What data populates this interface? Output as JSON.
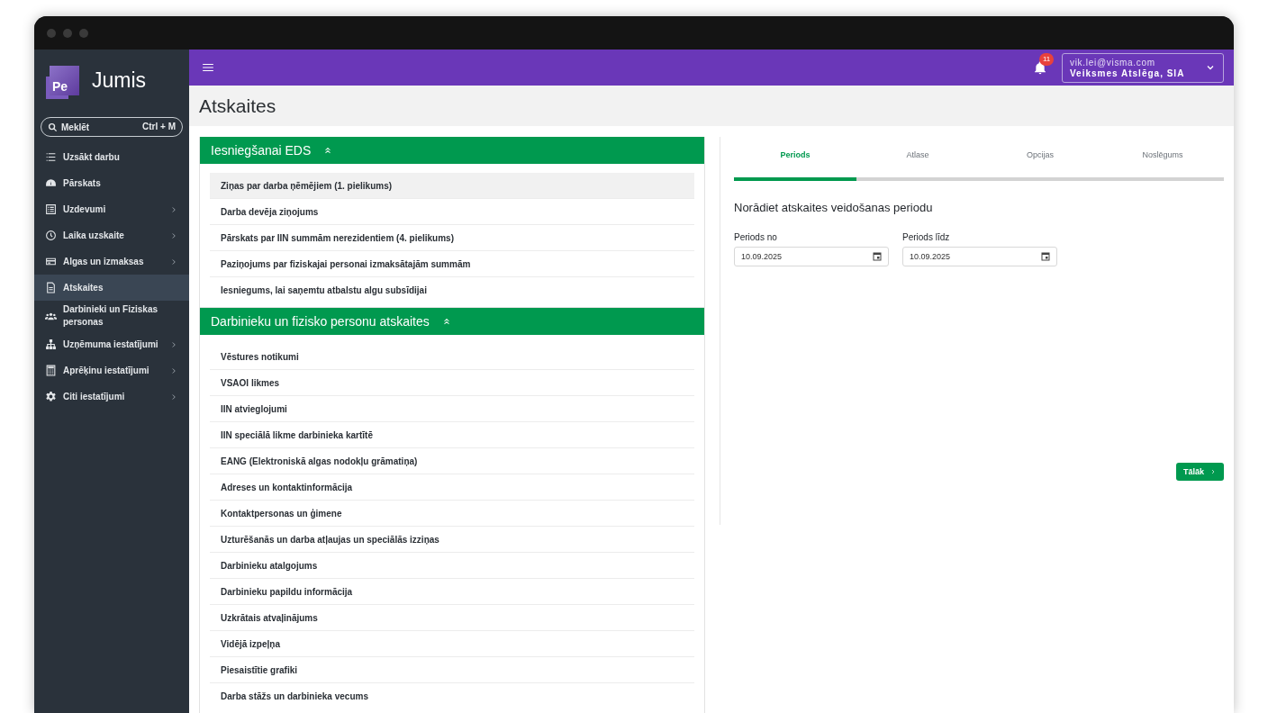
{
  "sidebar": {
    "logo": {
      "mark": "Pe",
      "name": "Jumis"
    },
    "search": {
      "placeholder": "Meklēt",
      "shortcut": "Ctrl + M"
    },
    "items": [
      {
        "label": "Uzsākt darbu",
        "expandable": false,
        "selected": false
      },
      {
        "label": "Pārskats",
        "expandable": false,
        "selected": false
      },
      {
        "label": "Uzdevumi",
        "expandable": true,
        "selected": false
      },
      {
        "label": "Laika uzskaite",
        "expandable": true,
        "selected": false
      },
      {
        "label": "Algas un izmaksas",
        "expandable": true,
        "selected": false
      },
      {
        "label": "Atskaites",
        "expandable": false,
        "selected": true
      },
      {
        "label": "Darbinieki un Fiziskas personas",
        "expandable": false,
        "selected": false
      },
      {
        "label": "Uzņēmuma iestatījumi",
        "expandable": true,
        "selected": false
      },
      {
        "label": "Aprēķinu iestatījumi",
        "expandable": true,
        "selected": false
      },
      {
        "label": "Citi iestatījumi",
        "expandable": true,
        "selected": false
      }
    ]
  },
  "topbar": {
    "notifications": "11",
    "account": {
      "email": "vik.lei@visma.com",
      "company": "Veiksmes Atslēga, SIA"
    }
  },
  "page_title": "Atskaites",
  "sections": [
    {
      "title": "Iesniegšanai EDS",
      "expanded": true,
      "items": [
        {
          "label": "Ziņas par darba ņēmējiem (1. pielikums)",
          "selected": true
        },
        {
          "label": "Darba devēja ziņojums",
          "selected": false
        },
        {
          "label": "Pārskats par IIN summām nerezidentiem (4. pielikums)",
          "selected": false
        },
        {
          "label": "Paziņojums par fiziskajai personai izmaksātajām summām",
          "selected": false
        },
        {
          "label": "Iesniegums, lai saņemtu atbalstu algu subsīdijai",
          "selected": false
        }
      ]
    },
    {
      "title": "Darbinieku un fizisko personu atskaites",
      "expanded": true,
      "items": [
        {
          "label": "Vēstures notikumi",
          "selected": false
        },
        {
          "label": "VSAOI likmes",
          "selected": false
        },
        {
          "label": "IIN atvieglojumi",
          "selected": false
        },
        {
          "label": "IIN speciālā likme darbinieka kartītē",
          "selected": false
        },
        {
          "label": "EANG (Elektroniskā algas nodokļu grāmatiņa)",
          "selected": false
        },
        {
          "label": "Adreses un kontaktinformācija",
          "selected": false
        },
        {
          "label": "Kontaktpersonas un ģimene",
          "selected": false
        },
        {
          "label": "Uzturēšanās un darba atļaujas un speciālās izziņas",
          "selected": false
        },
        {
          "label": "Darbinieku atalgojums",
          "selected": false
        },
        {
          "label": "Darbinieku papildu informācija",
          "selected": false
        },
        {
          "label": "Uzkrātais atvaļinājums",
          "selected": false
        },
        {
          "label": "Vidējā izpeļņa",
          "selected": false
        },
        {
          "label": "Piesaistītie grafiki",
          "selected": false
        },
        {
          "label": "Darba stāžs un darbinieka vecums",
          "selected": false
        }
      ]
    }
  ],
  "wizard": {
    "steps": [
      {
        "label": "Periods",
        "selected": true
      },
      {
        "label": "Atlase",
        "selected": false
      },
      {
        "label": "Opcijas",
        "selected": false
      },
      {
        "label": "Noslēgums",
        "selected": false
      }
    ],
    "heading": "Norādiet atskaites veidošanas periodu",
    "fields": [
      {
        "label": "Periods no",
        "value": "10.09.2025"
      },
      {
        "label": "Periods līdz",
        "value": "10.09.2025"
      }
    ],
    "next_button": "Tālāk"
  }
}
